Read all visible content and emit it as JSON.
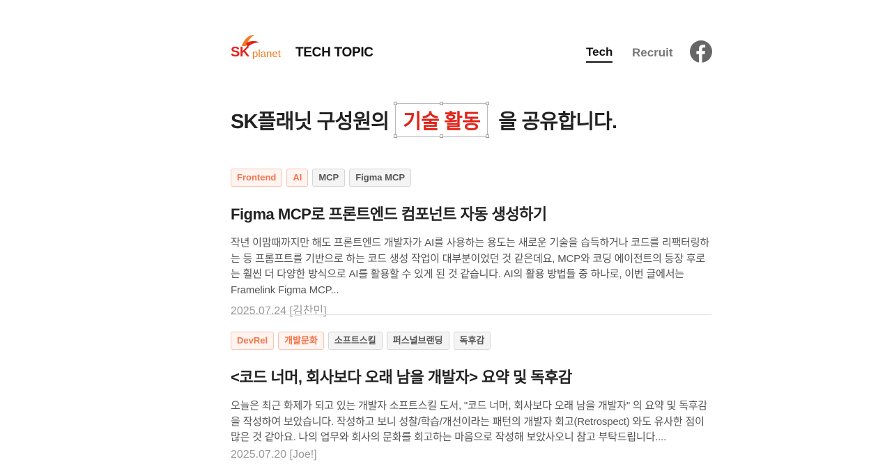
{
  "header": {
    "logo_sk": "SK",
    "logo_planet": "planet",
    "site_title": "TECH TOPIC",
    "nav": {
      "tech": "Tech",
      "recruit": "Recruit"
    }
  },
  "hero": {
    "prefix": "SK플래닛 구성원의",
    "highlight": "기술 활동",
    "suffix": "을 공유합니다."
  },
  "posts": [
    {
      "tags": [
        {
          "label": "Frontend",
          "style": "orange"
        },
        {
          "label": "AI",
          "style": "orange"
        },
        {
          "label": "MCP",
          "style": "gray"
        },
        {
          "label": "Figma MCP",
          "style": "gray"
        }
      ],
      "title": "Figma MCP로 프론트엔드 컴포넌트 자동 생성하기",
      "description": "작년 이맘때까지만 해도 프론트엔드 개발자가 AI를 사용하는 용도는 새로운 기술을 습득하거나 코드를 리팩터링하는 등 프롬프트를 기반으로 하는 코드 생성 작업이 대부분이었던 것 같은데요, MCP와 코딩 에이전트의 등장 후로는 훨씬 더 다양한 방식으로 AI를 활용할 수 있게 된 것 같습니다. AI의 활용 방법들 중 하나로, 이번 글에서는 Framelink Figma MCP...",
      "meta": "2025.07.24 [김찬민]"
    },
    {
      "tags": [
        {
          "label": "DevRel",
          "style": "orange"
        },
        {
          "label": "개발문화",
          "style": "orange"
        },
        {
          "label": "소프트스킬",
          "style": "gray"
        },
        {
          "label": "퍼스널브랜딩",
          "style": "gray"
        },
        {
          "label": "독후감",
          "style": "gray"
        }
      ],
      "title": "<코드 너머, 회사보다 오래 남을 개발자> 요약 및 독후감",
      "description": "오늘은 최근 화제가 되고 있는 개발자 소프트스킬 도서, \"코드 너머, 회사보다 오래 남을 개발자\" 의 요약 및 독후감을 작성하여 보았습니다. 작성하고 보니 성찰/학습/개선이라는 패턴의 개발자 회고(Retrospect) 와도 유사한 점이 많은 것 같아요. 나의 업무와 회사의 문화를 회고하는 마음으로 작성해 보았사오니 참고 부탁드립니다....",
      "meta": "2025.07.20 [Joe!]"
    }
  ],
  "colors": {
    "brand_red": "#e2231a",
    "brand_orange": "#f47920",
    "tag_orange": "#f4754c",
    "facebook": "#666666"
  },
  "icons": {
    "facebook": "facebook-icon",
    "logo": "sk-planet-wing-icon"
  }
}
